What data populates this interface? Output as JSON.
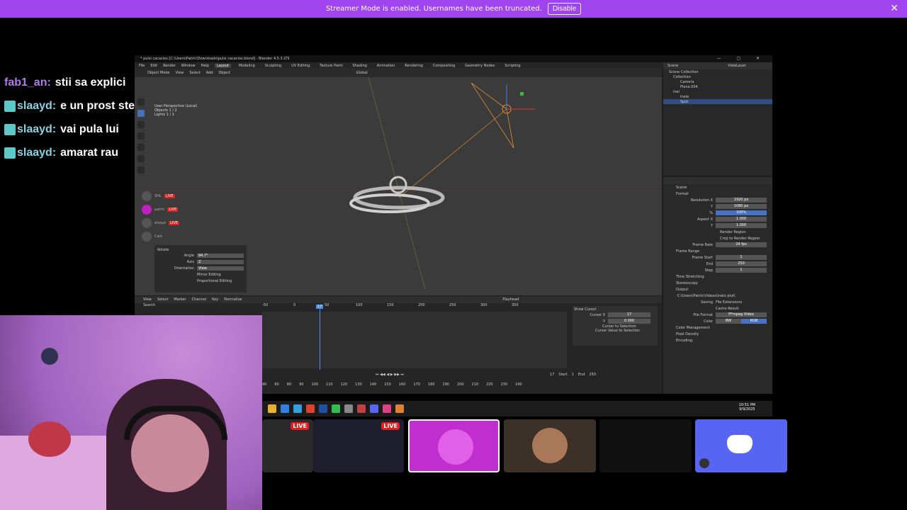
{
  "banner": {
    "text": "Streamer Mode is enabled. Usernames have been truncated.",
    "button": "Disable"
  },
  "chat": [
    {
      "user": "fab1_an:",
      "text": "stii sa explici"
    },
    {
      "user": "slaayd:",
      "text": "e un prost stezy asta"
    },
    {
      "user": "slaayd:",
      "text": "vai pula lui"
    },
    {
      "user": "slaayd:",
      "text": "amarat rau"
    }
  ],
  "blender": {
    "title": "* pulsi cacacios [C:\\Users\\Patric\\Downloads\\pulsi cacacios.blend] - Blender 4.5.3 LTS",
    "menu": [
      "File",
      "Edit",
      "Render",
      "Window",
      "Help"
    ],
    "workspaces": [
      "Layout",
      "Modeling",
      "Sculpting",
      "UV Editing",
      "Texture Paint",
      "Shading",
      "Animation",
      "Rendering",
      "Compositing",
      "Geometry Nodes",
      "Scripting"
    ],
    "active_workspace": "Layout",
    "viewport_header": [
      "Object Mode",
      "View",
      "Select",
      "Add",
      "Object"
    ],
    "transform": "Global",
    "stats": [
      "User Perspective (Local)",
      "Objects 1 / 2",
      "Lights 1 / 1"
    ],
    "rotate": {
      "title": "Rotate",
      "angle_label": "Angle",
      "angle": "94.7°",
      "axis_label": "Axis",
      "axis": "Z",
      "orientation_label": "Orientation",
      "orientation": "View",
      "mirror": "Mirror Editing",
      "proportional": "Proportional Editing"
    },
    "overlay_users": [
      "SHL",
      "patric",
      "elsaye",
      "Cam"
    ],
    "live": "LIVE",
    "outliner": {
      "header": "Scene",
      "layer": "ViewLayer",
      "items": [
        "Scene Collection",
        "Collection",
        "Camera",
        "Plane.004",
        "inel",
        "Inele",
        "Spot"
      ],
      "selected": "Spot"
    },
    "props": {
      "scene": "Scene",
      "format": "Format",
      "rows": [
        {
          "label": "Resolution X",
          "value": "1920 px"
        },
        {
          "label": "Y",
          "value": "1080 px"
        },
        {
          "label": "%",
          "value": "100%"
        },
        {
          "label": "Aspect X",
          "value": "1.000"
        },
        {
          "label": "Y",
          "value": "1.000"
        }
      ],
      "render_region": "Render Region",
      "crop": "Crop to Render Region",
      "frame_rate_label": "Frame Rate",
      "frame_rate": "24 fps",
      "frame_range": "Frame Range",
      "frame_rows": [
        {
          "label": "Frame Start",
          "value": "1"
        },
        {
          "label": "End",
          "value": "250"
        },
        {
          "label": "Step",
          "value": "1"
        }
      ],
      "time_stretching": "Time Stretching",
      "stereoscopy": "Stereoscopy",
      "output": "Output",
      "path": "C:\\Users\\Patric\\Videos\\inelo plut\\",
      "saving_label": "Saving",
      "file_ext": "File Extensions",
      "cache": "Cache Result",
      "file_format_label": "File Format",
      "file_format": "FFmpeg Video",
      "color_label": "Color",
      "bw": "BW",
      "rgb": "RGB",
      "color_mgmt": "Color Management",
      "pixel_density": "Pixel Density",
      "encoding": "Encoding"
    },
    "timeline": {
      "header": [
        "View",
        "Select",
        "Marker",
        "Channel",
        "Key",
        "Normalize"
      ],
      "playhead": "17",
      "ruler": [
        "-50",
        "0",
        "50",
        "100",
        "150",
        "200",
        "250",
        "300",
        "350"
      ],
      "ruler2": [
        "40",
        "60",
        "80",
        "90",
        "100",
        "110",
        "120",
        "130",
        "140",
        "150",
        "160",
        "170",
        "180",
        "190",
        "200",
        "210",
        "220",
        "230",
        "240"
      ],
      "show_cursor": "Show Cursor",
      "cursor_x_label": "Cursor X",
      "cursor_x": "17",
      "cursor_y_label": "Y",
      "cursor_y": "0.000",
      "cursor_to_sel": "Cursor to Selection",
      "cursor_val_sel": "Cursor Value to Selection",
      "current": "17",
      "start_label": "Start",
      "start": "1",
      "end_label": "End",
      "end": "250",
      "search": "Search",
      "playhead_label": "Playhead"
    },
    "clock": {
      "time": "10:51 PM",
      "date": "9/9/2025"
    }
  }
}
